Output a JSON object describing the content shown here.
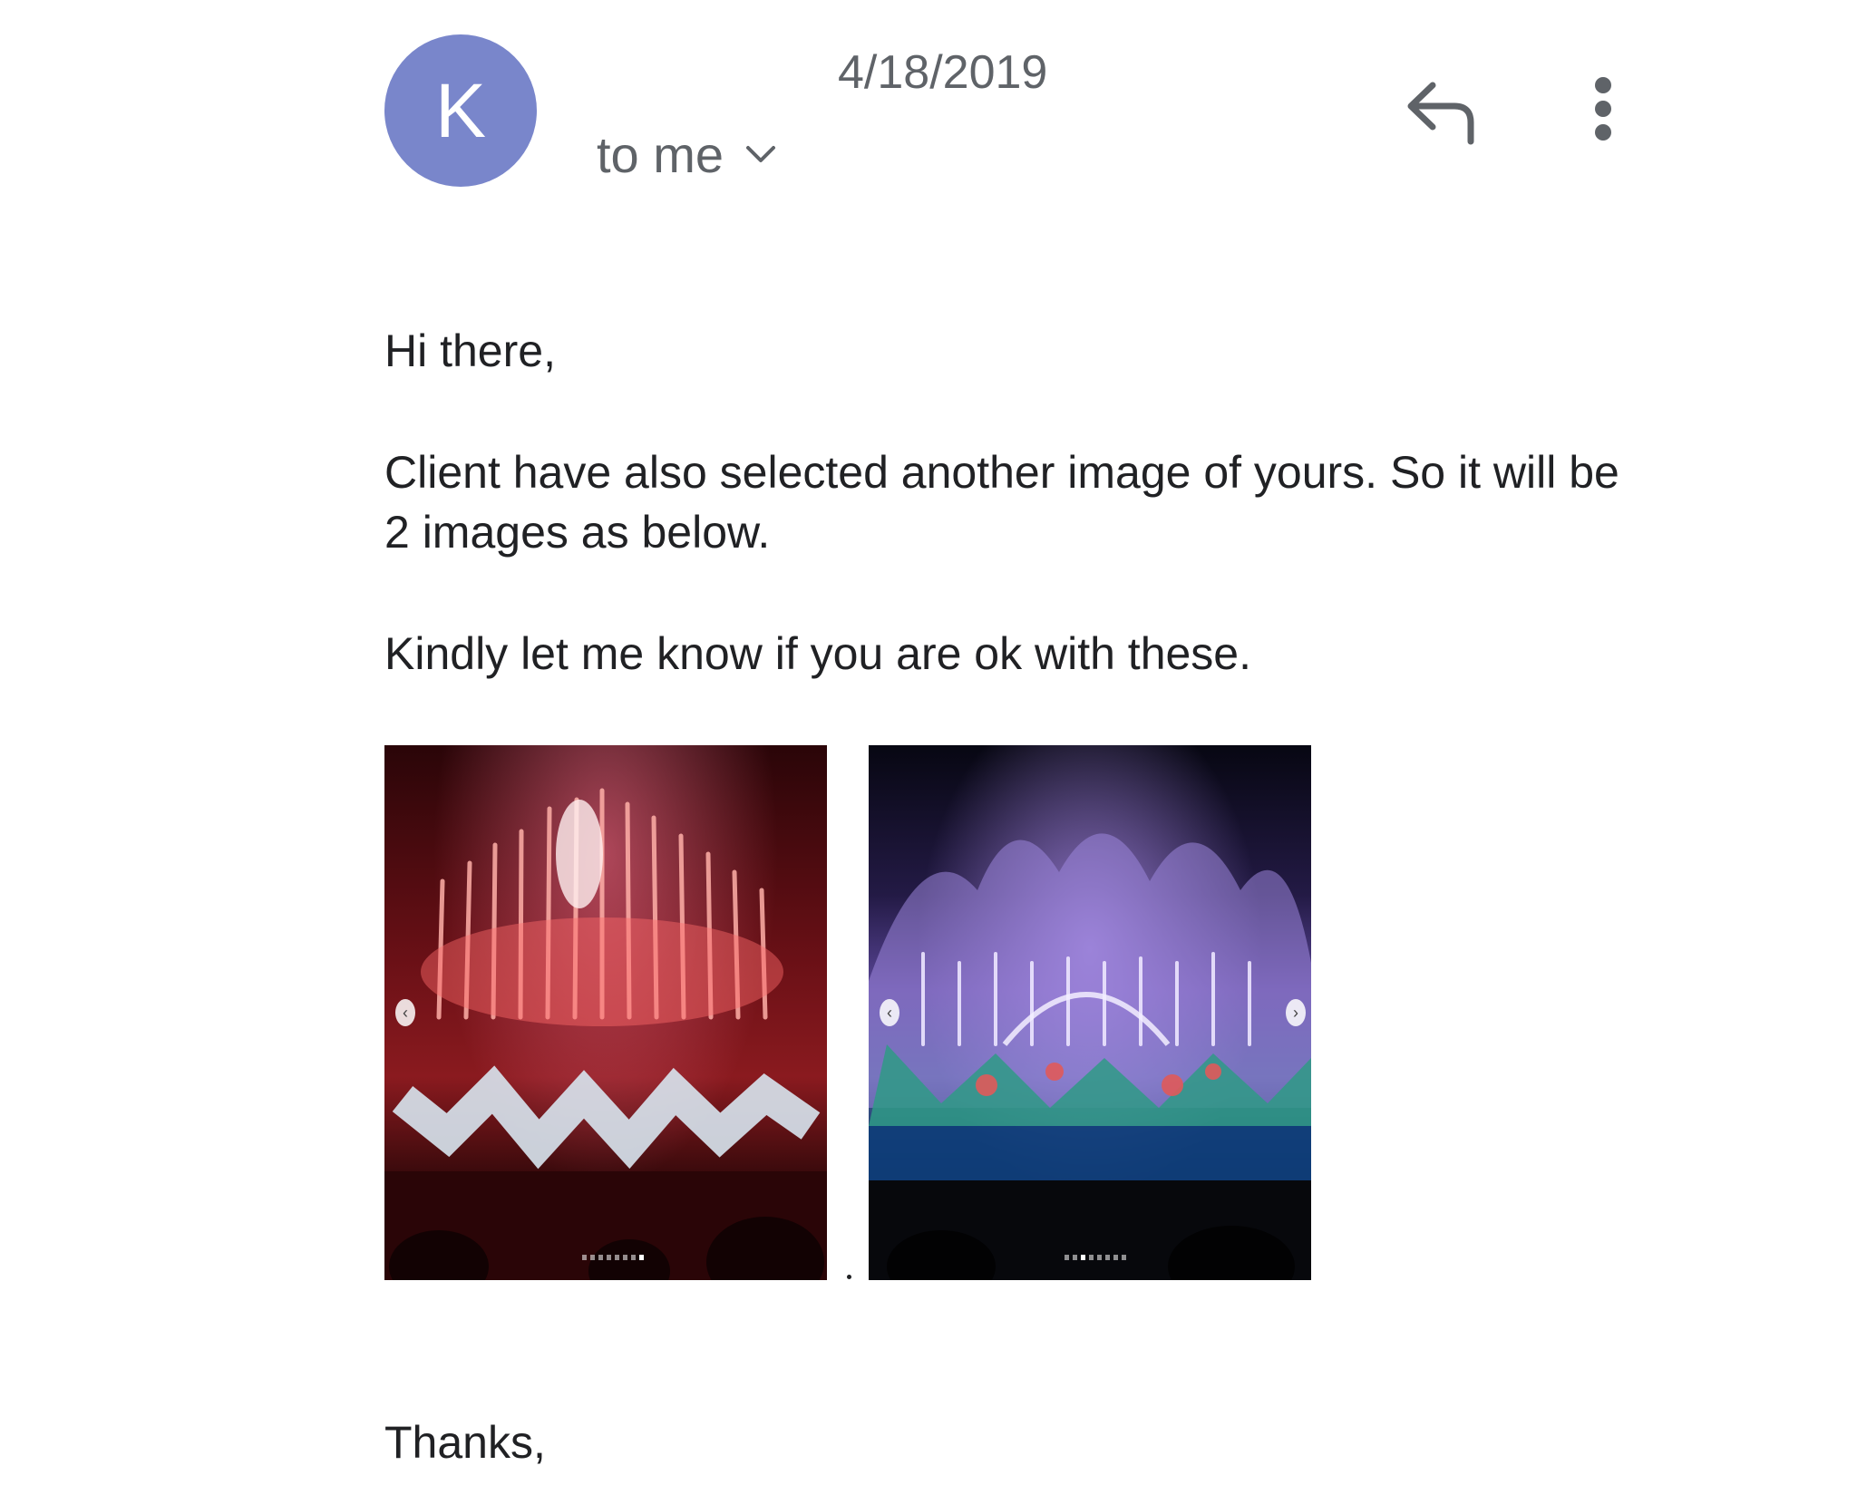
{
  "header": {
    "avatar_initial": "K",
    "date": "4/18/2019",
    "recipient_label": "to me",
    "avatar_color": "#7986cb"
  },
  "actions": {
    "reply_icon": "reply-icon",
    "more_icon": "more-vert-icon"
  },
  "message": {
    "greeting": "Hi there,",
    "paragraph_1": "Client have also selected another image of yours. So it will be 2 images as below.",
    "paragraph_2": "Kindly let me know if you are ok with these.",
    "sign_off": "Thanks,"
  },
  "attachments": [
    {
      "description": "fireworks-over-fountain-show",
      "carousel_dot_count": 8,
      "carousel_active_index": 7
    },
    {
      "description": "purple-fountain-show",
      "carousel_dot_count": 8,
      "carousel_active_index": 2
    }
  ]
}
